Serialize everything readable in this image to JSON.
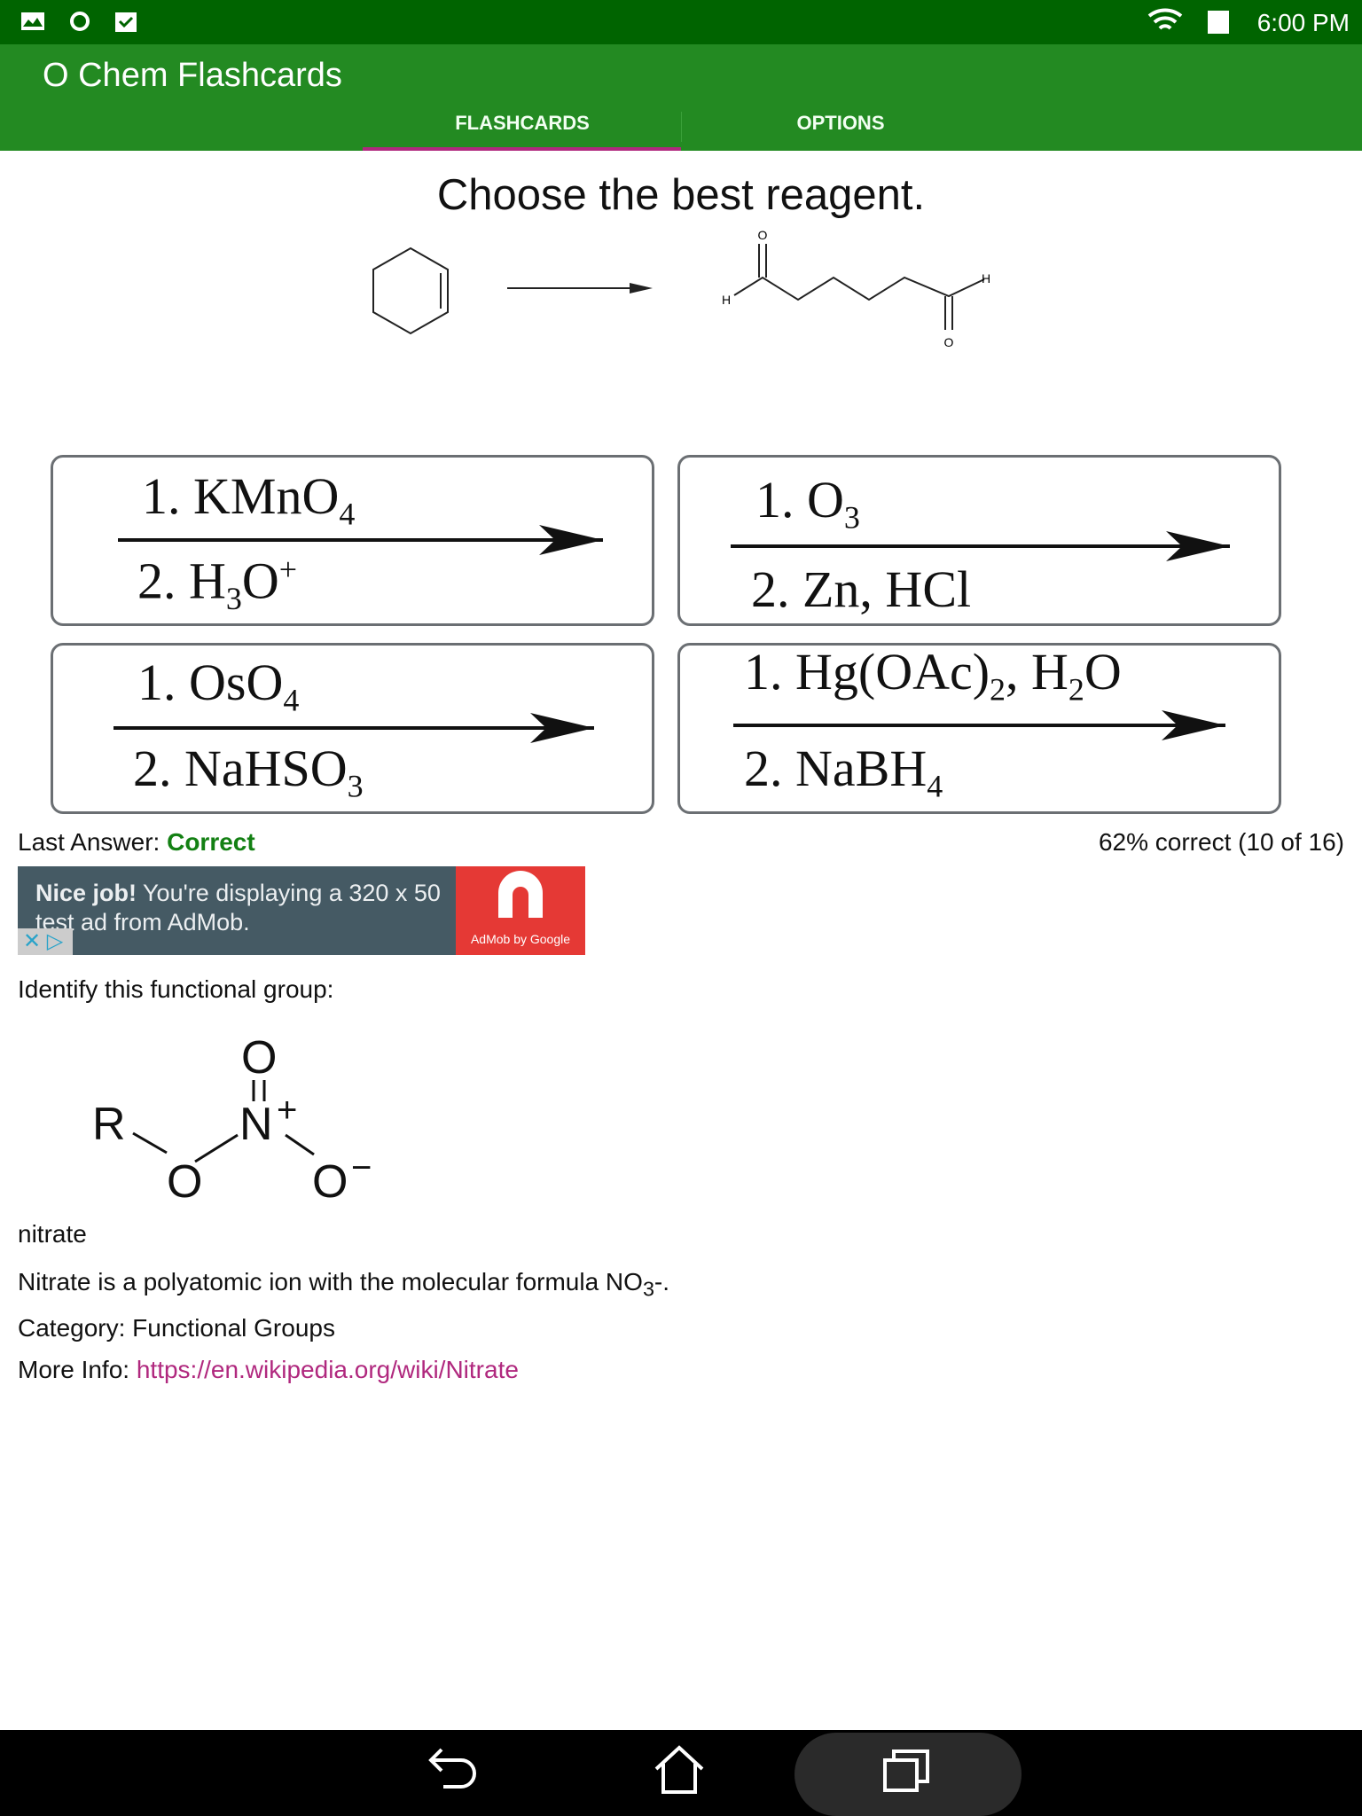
{
  "status_bar": {
    "time": "6:00 PM",
    "icons": [
      "gallery-icon",
      "sync-icon",
      "clipboard-check-icon",
      "wifi-icon",
      "battery-icon"
    ]
  },
  "app": {
    "title": "O Chem Flashcards",
    "tabs": [
      {
        "label": "FLASHCARDS",
        "active": true
      },
      {
        "label": "OPTIONS",
        "active": false
      }
    ],
    "accent": "#b0287e",
    "bar_color": "#238a22"
  },
  "question": {
    "prompt": "Choose the best reagent.",
    "reaction": {
      "start_label": "",
      "product_labels": {
        "o": "O",
        "h": "H"
      }
    }
  },
  "answers": [
    {
      "l1": "1. KMnO",
      "l1sub": "4",
      "l2": "2. H",
      "l2sub": "3",
      "l2b": "O",
      "l2sup": "+"
    },
    {
      "l1": "1. O",
      "l1sub": "3",
      "l2": "2. Zn, HCl"
    },
    {
      "l1": "1. OsO",
      "l1sub": "4",
      "l2": "2. NaHSO",
      "l2sub": "3"
    },
    {
      "l1": "1. Hg(OAc)",
      "l1sub": "2",
      "l1b": ", H",
      "l1sub2": "2",
      "l1c": "O",
      "l2": "2. NaBH",
      "l2sub": "4"
    }
  ],
  "result": {
    "label": "Last Answer: ",
    "value": "Correct",
    "value_color": "#138013",
    "score": "62% correct (10 of 16)"
  },
  "ad": {
    "bold": "Nice job!",
    "text": " You're displaying a 320 x 50 test ad from AdMob.",
    "brand": "AdMob by Google"
  },
  "previous": {
    "prompt": "Identify this functional group:",
    "structure": {
      "r": "R",
      "o": "O",
      "n": "N",
      "plus": "+",
      "minus": "−"
    },
    "name": "nitrate",
    "desc_pre": "Nitrate is a polyatomic ion with the molecular formula NO",
    "desc_sub": "3",
    "desc_post": "-.",
    "category": "Category: Functional Groups",
    "more_label": "More Info: ",
    "more_link": "https://en.wikipedia.org/wiki/Nitrate"
  },
  "nav": {
    "icons": [
      "back-icon",
      "home-icon",
      "recents-icon"
    ]
  }
}
